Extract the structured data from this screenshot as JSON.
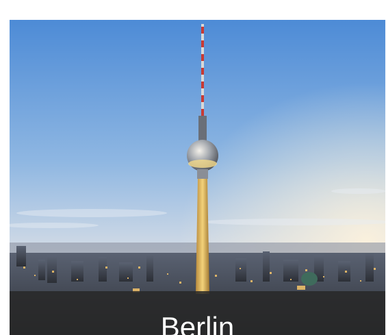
{
  "card": {
    "city_name": "Berlin",
    "image_subject": "berlin-tv-tower-skyline-photo"
  },
  "colors": {
    "caption_bg": "#282828",
    "caption_text": "#ffffff",
    "sky_top": "#4d8bd6",
    "sky_horizon": "#f4e6cf"
  }
}
